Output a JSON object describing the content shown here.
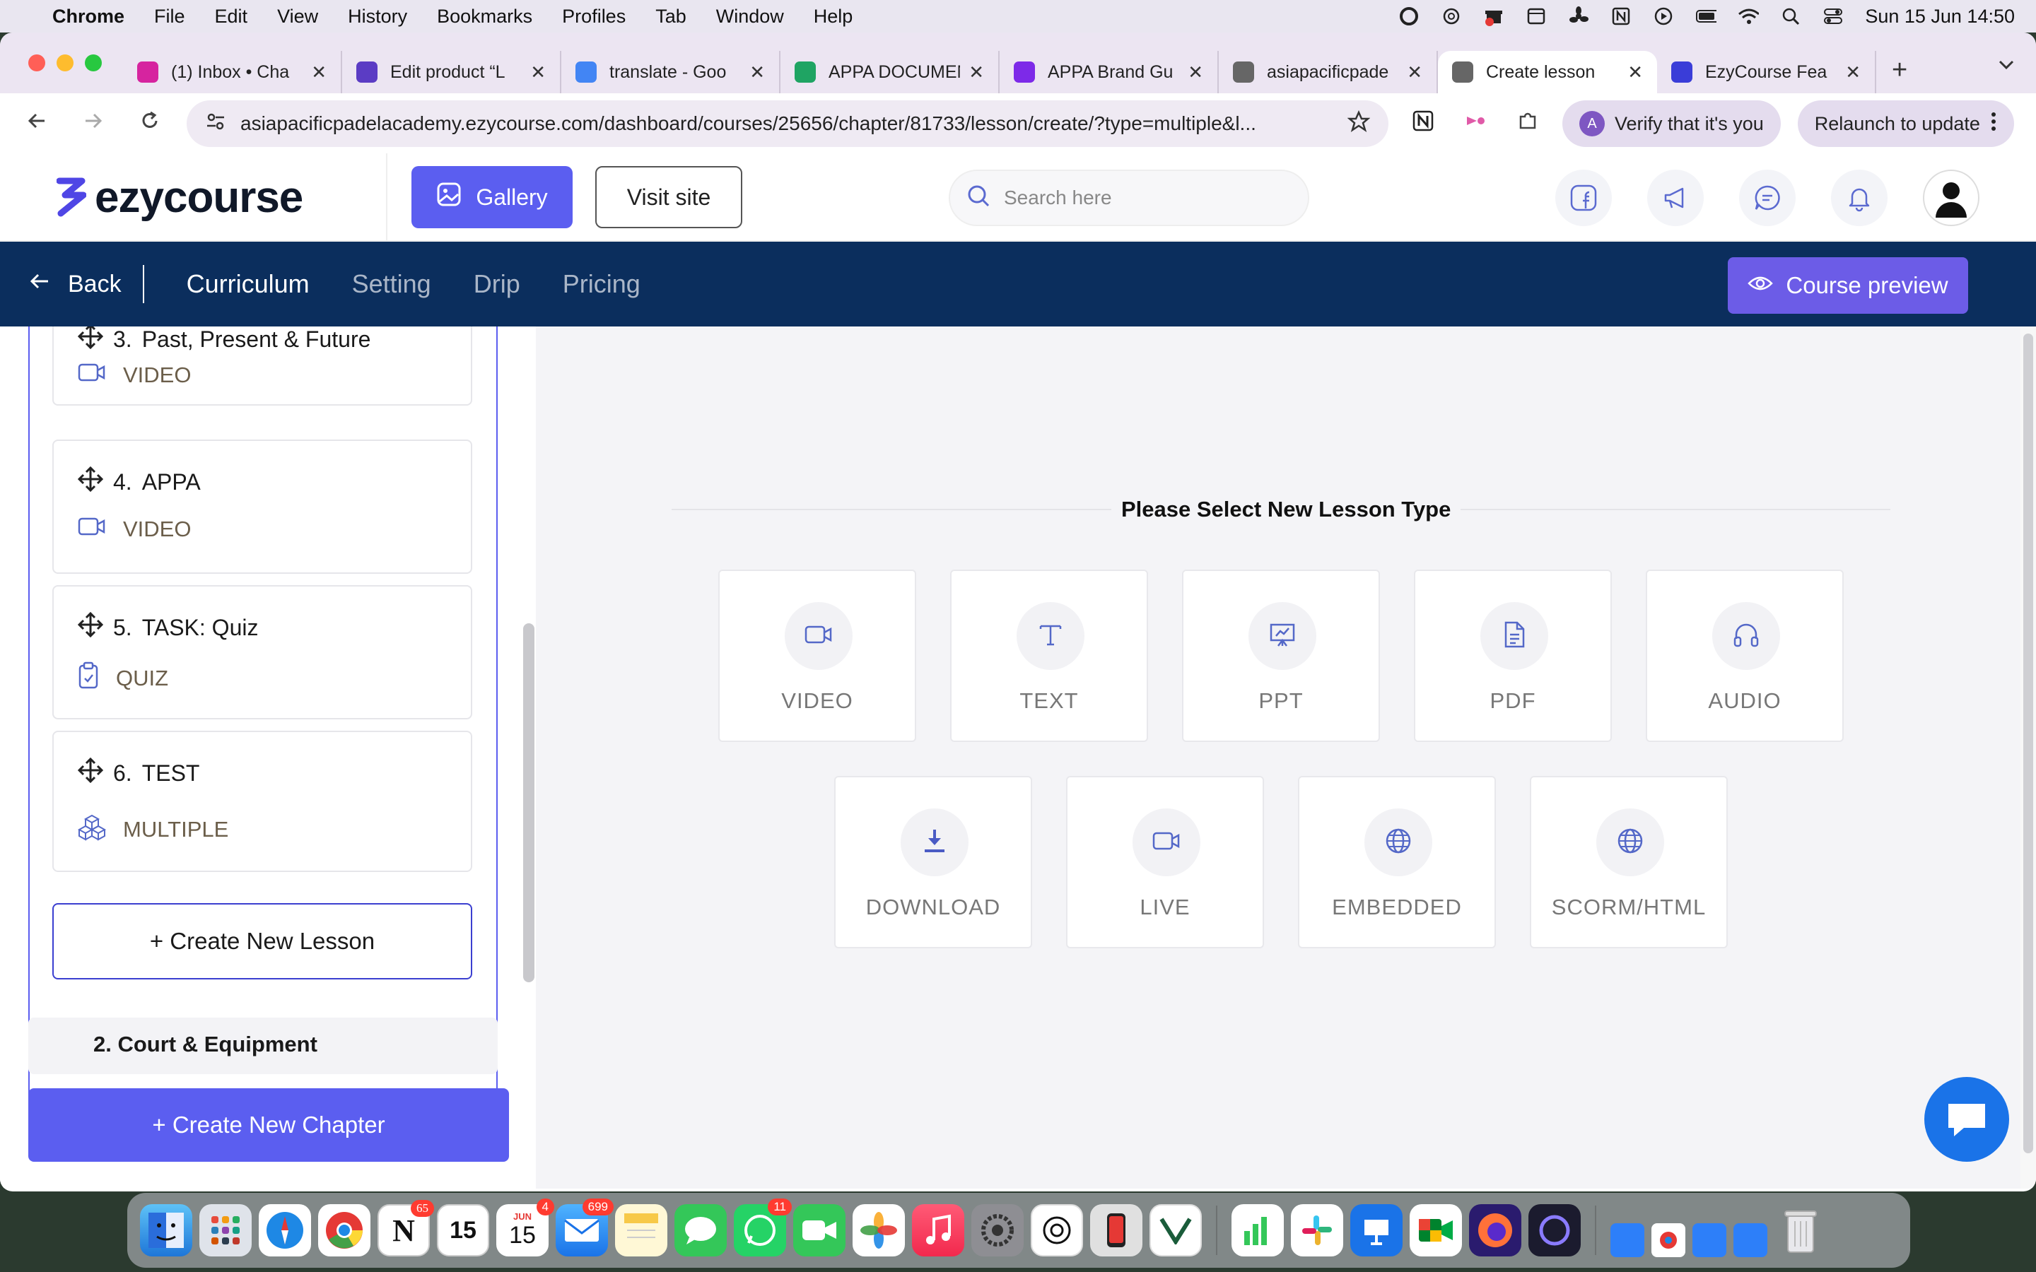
{
  "menubar": {
    "app": "Chrome",
    "items": [
      "File",
      "Edit",
      "View",
      "History",
      "Bookmarks",
      "Profiles",
      "Tab",
      "Window",
      "Help"
    ],
    "clock": "Sun 15 Jun  14:50"
  },
  "browser": {
    "tabs": [
      {
        "title": "(1) Inbox • Cha",
        "icon": "instagram-icon",
        "color": "#d6249f"
      },
      {
        "title": "Edit product “L",
        "icon": "chat-icon",
        "color": "#5b3cc4"
      },
      {
        "title": "translate - Goo",
        "icon": "google-icon",
        "color": "#4285f4"
      },
      {
        "title": "APPA DOCUMEN",
        "icon": "drive-icon",
        "color": "#1fa463"
      },
      {
        "title": "APPA Brand Gu",
        "icon": "canva-icon",
        "color": "#7d2ae8"
      },
      {
        "title": "asiapacificpade",
        "icon": "globe-icon",
        "color": "#666666"
      },
      {
        "title": "Create lesson",
        "icon": "globe-icon",
        "color": "#666666"
      },
      {
        "title": "EzyCourse Fea",
        "icon": "ezycourse-icon",
        "color": "#3a3dd8"
      }
    ],
    "url": "asiapacificpadelacademy.ezycourse.com/dashboard/courses/25656/chapter/81733/lesson/create/?type=multiple&l...",
    "profile_initial": "A",
    "verify_label": "Verify that it's you",
    "relaunch_label": "Relaunch to update"
  },
  "header": {
    "logo_text": "ezycourse",
    "gallery_label": "Gallery",
    "visit_label": "Visit site",
    "search_placeholder": "Search here"
  },
  "course_nav": {
    "back_label": "Back",
    "tabs": [
      "Curriculum",
      "Setting",
      "Drip",
      "Pricing"
    ],
    "active_tab": "Curriculum",
    "preview_label": "Course preview"
  },
  "sidebar": {
    "lessons": [
      {
        "number": "3.",
        "title": "Past, Present & Future",
        "type": "VIDEO"
      },
      {
        "number": "4.",
        "title": "APPA",
        "type": "VIDEO"
      },
      {
        "number": "5.",
        "title": "TASK: Quiz",
        "type": "QUIZ"
      },
      {
        "number": "6.",
        "title": "TEST",
        "type": "MULTIPLE"
      }
    ],
    "create_lesson_label": "+ Create New Lesson",
    "next_chapter": {
      "number": "2.",
      "title": "Court & Equipment"
    },
    "create_chapter_label": "+ Create New Chapter"
  },
  "main": {
    "heading": "Please Select New Lesson Type",
    "lesson_types": [
      "VIDEO",
      "TEXT",
      "PPT",
      "PDF",
      "AUDIO",
      "DOWNLOAD",
      "LIVE",
      "EMBEDDED",
      "SCORM/HTML"
    ]
  },
  "dock": {
    "badges": {
      "notion": "65",
      "calendar": "4",
      "mail": "699",
      "whatsapp": "11"
    },
    "calendar_day": "15",
    "calendar_month": "JUN"
  },
  "colors": {
    "accent": "#5b5ef0",
    "nav_bg": "#0b2e5d",
    "preview_btn": "#6c5ce7",
    "icon_blue": "#5468c8"
  }
}
